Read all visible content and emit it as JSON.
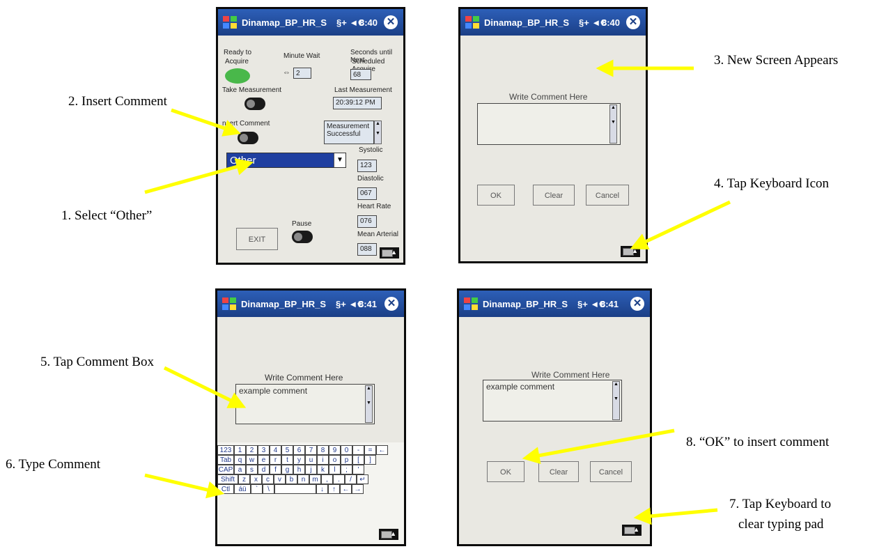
{
  "annotations": {
    "step1": "1. Select “Other”",
    "step2": "2. Insert Comment",
    "step3": "3. New Screen Appears",
    "step4": "4. Tap Keyboard Icon",
    "step5": "5. Tap Comment Box",
    "step6": "6. Type Comment",
    "step7_line1": "7. Tap Keyboard to",
    "step7_line2": "clear typing pad",
    "step8": "8. “OK” to insert comment"
  },
  "colors": {
    "arrow": "#ffff00",
    "titlebar": "#1b3f86",
    "selection": "#1f3fa0",
    "status_green": "#49b84a"
  },
  "screens": [
    {
      "title": "Dinamap_BP_HR_S",
      "status_icons": "§+ ◄€",
      "time": "8:40",
      "ready_label_1": "Ready to",
      "ready_label_2": "Acquire",
      "minute_wait_label": "Minute Wait",
      "minute_wait_value": "2",
      "seconds_label_1": "Seconds until Next",
      "seconds_label_2": "Scheduled Acquire",
      "seconds_value": "68",
      "take_measurement_label": "Take Measurement",
      "last_measurement_label": "Last Measurement",
      "last_measurement_value": "20:39:12 PM",
      "insert_comment_label": "nsert Comment",
      "status_message": "Measurement Successful",
      "dropdown_value": "Other",
      "systolic_label": "Systolic",
      "systolic_value": "123",
      "diastolic_label": "Diastolic",
      "diastolic_value": "067",
      "heart_rate_label": "Heart Rate",
      "heart_rate_value": "076",
      "pause_label": "Pause",
      "exit_label": "EXIT",
      "mean_arterial_label": "Mean Arterial",
      "mean_arterial_value": "088"
    },
    {
      "title": "Dinamap_BP_HR_S",
      "status_icons": "§+ ◄€",
      "time": "8:40",
      "prompt": "Write Comment Here",
      "comment": "",
      "ok": "OK",
      "clear": "Clear",
      "cancel": "Cancel"
    },
    {
      "title": "Dinamap_BP_HR_S",
      "status_icons": "§+ ◄€",
      "time": "8:41",
      "prompt": "Write Comment Here",
      "comment": "example comment",
      "keyboard_rows": [
        [
          "123",
          "1",
          "2",
          "3",
          "4",
          "5",
          "6",
          "7",
          "8",
          "9",
          "0",
          "-",
          "=",
          "←"
        ],
        [
          "Tab",
          "q",
          "w",
          "e",
          "r",
          "t",
          "y",
          "u",
          "i",
          "o",
          "p",
          "[",
          "]"
        ],
        [
          "CAP",
          "a",
          "s",
          "d",
          "f",
          "g",
          "h",
          "j",
          "k",
          "l",
          ";",
          "'"
        ],
        [
          "Shift",
          "z",
          "x",
          "c",
          "v",
          "b",
          "n",
          "m",
          ",",
          ".",
          "/",
          "↵"
        ],
        [
          "Ctl",
          "áü",
          "`",
          "\\",
          " ",
          "↓",
          "↑",
          "←",
          "→"
        ]
      ]
    },
    {
      "title": "Dinamap_BP_HR_S",
      "status_icons": "§+ ◄€",
      "time": "8:41",
      "prompt": "Write Comment Here",
      "comment": "example comment",
      "ok": "OK",
      "clear": "Clear",
      "cancel": "Cancel"
    }
  ]
}
